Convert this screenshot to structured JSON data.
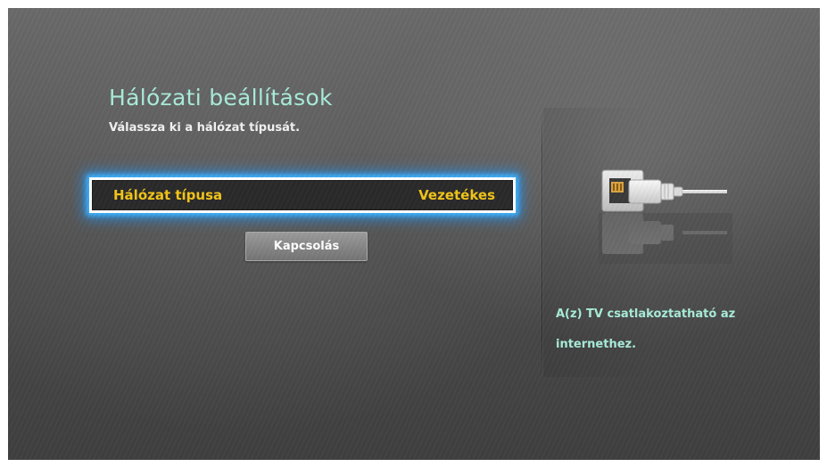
{
  "header": {
    "title": "Hálózati beállítások",
    "subtitle": "Válassza ki a hálózat típusát."
  },
  "network_type": {
    "label": "Hálózat típusa",
    "value": "Vezetékes"
  },
  "connect_button": {
    "label": "Kapcsolás"
  },
  "side_panel": {
    "icon": "ethernet-cable-icon",
    "info_text_line1": "A(z) TV csatlakoztatható az",
    "info_text_line2": "internethez."
  },
  "colors": {
    "title": "#a8ecd8",
    "highlight_text": "#f3c518",
    "focus_glow": "#3fb5ff"
  }
}
